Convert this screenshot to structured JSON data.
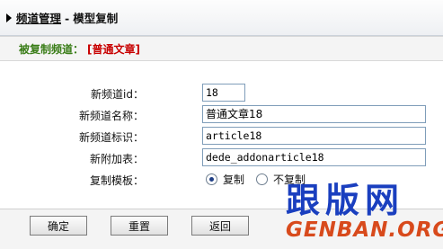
{
  "header": {
    "crumb_link": "频道管理",
    "separator": "-",
    "current": "模型复制"
  },
  "infobar": {
    "label": "被复制频道：",
    "value": "[普通文章]"
  },
  "form": {
    "channel_id": {
      "label": "新频道id：",
      "value": "18"
    },
    "channel_name": {
      "label": "新频道名称：",
      "value": "普通文章18"
    },
    "channel_tag": {
      "label": "新频道标识：",
      "value": "article18"
    },
    "addon_table": {
      "label": "新附加表：",
      "value": "dede_addonarticle18"
    },
    "copy_template": {
      "label": "复制模板：",
      "options": [
        {
          "label": "复制",
          "selected": true
        },
        {
          "label": "不复制",
          "selected": false
        }
      ]
    }
  },
  "buttons": {
    "confirm": "确定",
    "reset": "重置",
    "back": "返回"
  },
  "watermark": {
    "cn": "跟版网",
    "en": "GENBAN.ORG"
  }
}
